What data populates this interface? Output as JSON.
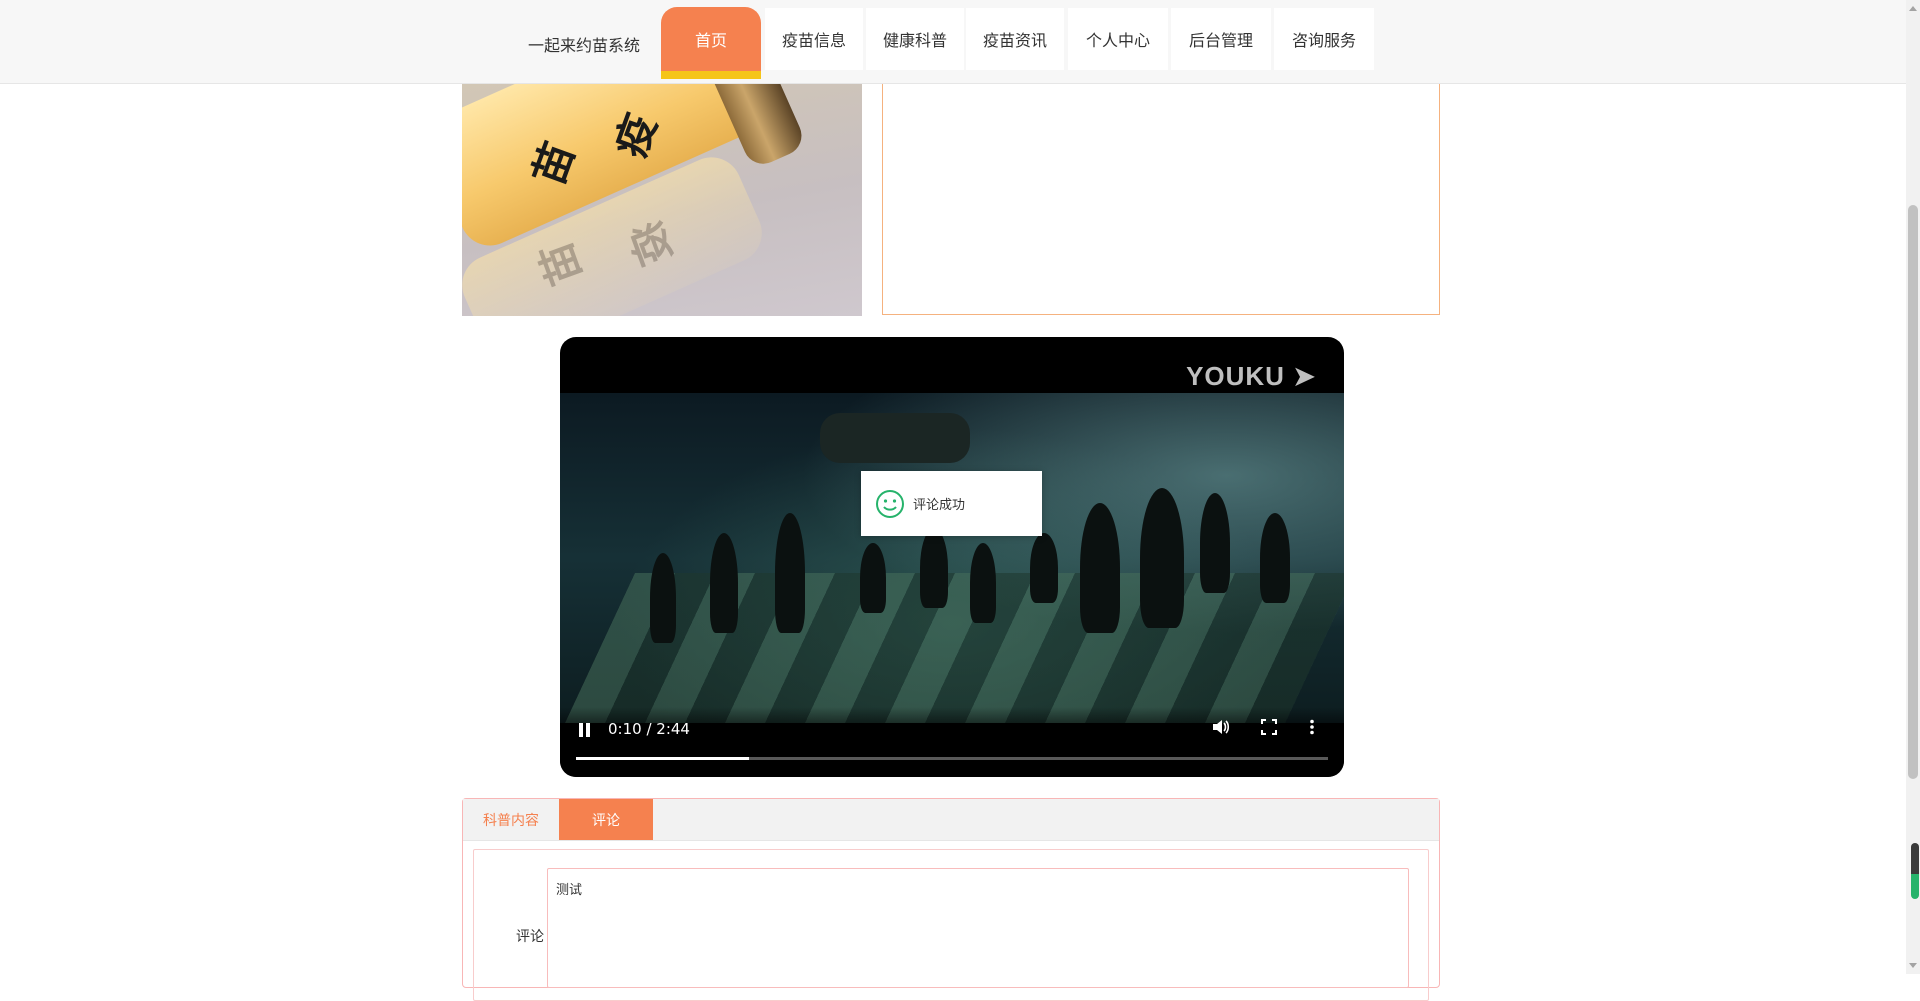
{
  "header": {
    "brand": "一起来约苗系统",
    "nav": [
      {
        "label": "首页",
        "active": true
      },
      {
        "label": "疫苗信息",
        "active": false
      },
      {
        "label": "健康科普",
        "active": false
      },
      {
        "label": "疫苗资讯",
        "active": false
      },
      {
        "label": "个人中心",
        "active": false
      },
      {
        "label": "后台管理",
        "active": false
      },
      {
        "label": "咨询服务",
        "active": false
      }
    ]
  },
  "hero_image": {
    "characters": [
      "疫",
      "苗"
    ]
  },
  "video": {
    "logo": "YOUKU",
    "time": "0:10 / 2:44",
    "progress": 0.23,
    "icons": [
      "pause-icon",
      "volume-icon",
      "fullscreen-icon",
      "more-icon"
    ]
  },
  "toast": {
    "message": "评论成功",
    "icon": "smile-icon"
  },
  "tabs": [
    {
      "label": "科普内容",
      "active": false
    },
    {
      "label": "评论",
      "active": true
    }
  ],
  "comment_form": {
    "label": "评论",
    "value": "测试"
  },
  "colors": {
    "accent": "#f5814f",
    "accent_underline": "#f5c518",
    "panel_border": "#f8b6b6",
    "toast_icon": "#26b36b"
  }
}
